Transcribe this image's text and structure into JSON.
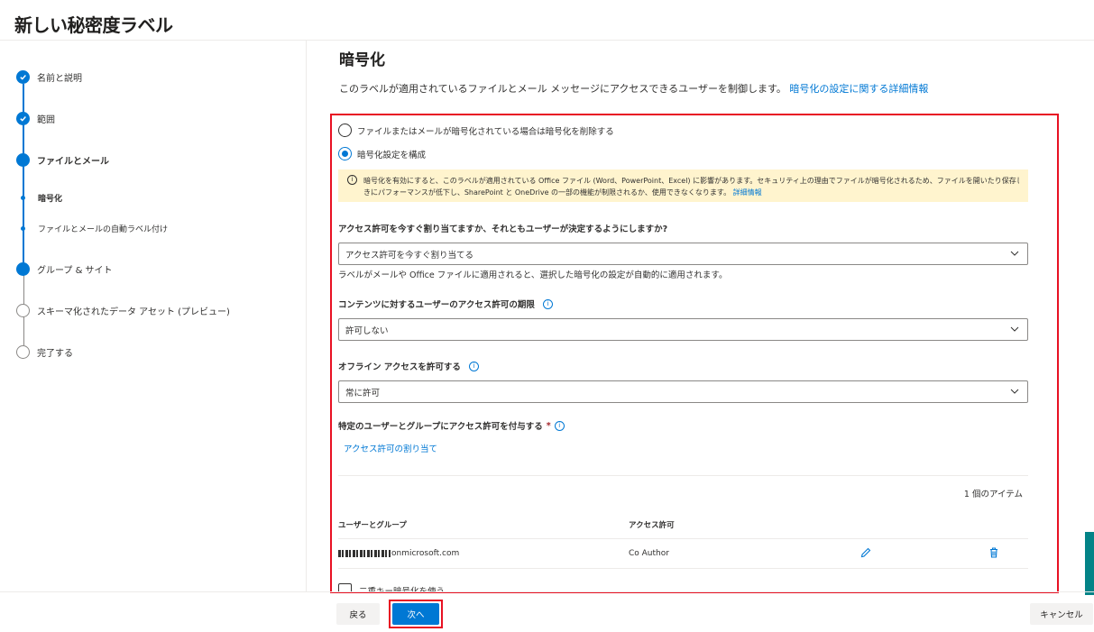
{
  "page": {
    "title": "新しい秘密度ラベル"
  },
  "steps": [
    {
      "label": "名前と説明",
      "state": "done"
    },
    {
      "label": "範囲",
      "state": "done"
    },
    {
      "label": "ファイルとメール",
      "state": "current"
    },
    {
      "label": "暗号化",
      "state": "sub-current"
    },
    {
      "label": "ファイルとメールの自動ラベル付け",
      "state": "sub"
    },
    {
      "label": "グループ & サイト",
      "state": "current-path"
    },
    {
      "label": "スキーマ化されたデータ アセット (プレビュー)",
      "state": "todo"
    },
    {
      "label": "完了する",
      "state": "todo"
    }
  ],
  "main": {
    "title": "暗号化",
    "description": "このラベルが適用されているファイルとメール メッセージにアクセスできるユーザーを制御します。",
    "description_link": "暗号化の設定に関する詳細情報",
    "radio_remove": "ファイルまたはメールが暗号化されている場合は暗号化を削除する",
    "radio_configure": "暗号化設定を構成",
    "warning_line1": "暗号化を有効にすると、このラベルが適用されている Office ファイル (Word、PowerPoint、Excel) に影響があります。セキュリティ上の理由でファイルが暗号化されるため、ファイルを開いたり保存したりすると",
    "warning_line2": "きにパフォーマンスが低下し、SharePoint と OneDrive の一部の機能が制限されるか、使用できなくなります。",
    "warning_link": "詳細情報",
    "q_assign": "アクセス許可を今すぐ割り当てますか、それともユーザーが決定するようにしますか?",
    "assign_value": "アクセス許可を今すぐ割り当てる",
    "assign_helper": "ラベルがメールや Office ファイルに適用されると、選択した暗号化の設定が自動的に適用されます。",
    "q_expire": "コンテンツに対するユーザーのアクセス許可の期限",
    "expire_value": "許可しない",
    "q_offline": "オフライン アクセスを許可する",
    "offline_value": "常に許可",
    "q_grant": "特定のユーザーとグループにアクセス許可を付与する",
    "grant_link": "アクセス許可の割り当て",
    "item_count": "1 個のアイテム",
    "col_users": "ユーザーとグループ",
    "col_perm": "アクセス許可",
    "row_user_suffix": "onmicrosoft.com",
    "row_perm": "Co Author",
    "double_key": "二重キー暗号化を使う"
  },
  "footer": {
    "back": "戻る",
    "next": "次へ",
    "cancel": "キャンセル"
  },
  "colors": {
    "accent": "#0078d4",
    "highlight": "#e81123",
    "warning_bg": "#fff4ce"
  }
}
